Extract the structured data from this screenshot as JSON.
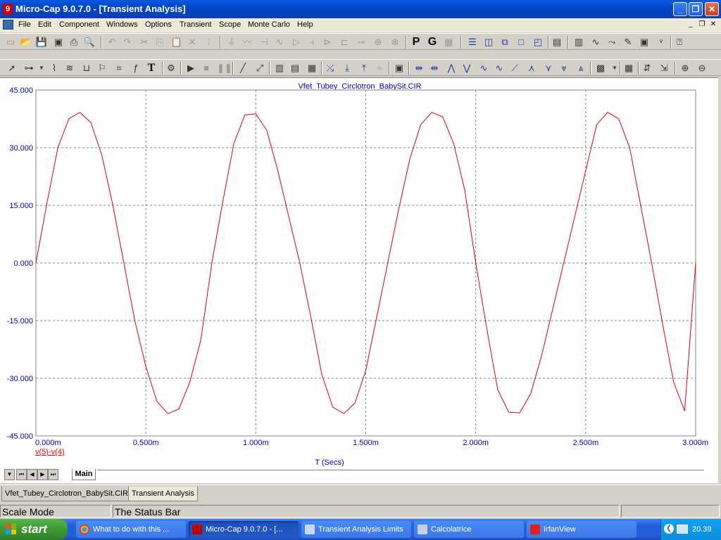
{
  "window": {
    "title": "Micro-Cap 9.0.7.0 - [Transient Analysis]",
    "logo_glyph": "9"
  },
  "menu": [
    "File",
    "Edit",
    "Component",
    "Windows",
    "Options",
    "Transient",
    "Scope",
    "Monte Carlo",
    "Help"
  ],
  "toolbar1": {
    "text_buttons": [
      "P",
      "G"
    ]
  },
  "plot": {
    "colors": {
      "curve": "#e00000",
      "axis_text": "#0000c0",
      "grid": "#808080"
    },
    "tab_label": "Main"
  },
  "chart_data": {
    "type": "line",
    "title": "Vfet_Tubey_Circlotron_BabySit.CIR",
    "xlabel": "T (Secs)",
    "ylabel": "",
    "xlim": [
      0,
      0.003
    ],
    "ylim": [
      -45,
      45
    ],
    "x_tick_labels": [
      "0.000m",
      "0.500m",
      "1.000m",
      "1.500m",
      "2.000m",
      "2.500m",
      "3.000m"
    ],
    "y_tick_labels": [
      "45.000",
      "30.000",
      "15.000",
      "0.000",
      "-15.000",
      "-30.000",
      "-45.000"
    ],
    "grid": true,
    "series": [
      {
        "name": "v(5)-v(4)",
        "color": "#e00000",
        "x": [
          0,
          5e-05,
          0.0001,
          0.00015,
          0.0002,
          0.00025,
          0.0003,
          0.00035,
          0.0004,
          0.00045,
          0.0005,
          0.00055,
          0.0006,
          0.00065,
          0.0007,
          0.00075,
          0.0008,
          0.00085,
          0.0009,
          0.00095,
          0.001,
          0.00105,
          0.0011,
          0.00115,
          0.0012,
          0.00125,
          0.0013,
          0.00135,
          0.0014,
          0.00145,
          0.0015,
          0.00155,
          0.0016,
          0.00165,
          0.0017,
          0.00175,
          0.0018,
          0.00185,
          0.0019,
          0.00195,
          0.002,
          0.00205,
          0.0021,
          0.00215,
          0.0022,
          0.00225,
          0.0023,
          0.00235,
          0.0024,
          0.00245,
          0.0025,
          0.00255,
          0.0026,
          0.00265,
          0.0027,
          0.00275,
          0.0028,
          0.00285,
          0.0029,
          0.00295,
          0.003
        ],
        "y": [
          0,
          15.5,
          30,
          37.5,
          39.2,
          36.5,
          28,
          15,
          0,
          -15,
          -27,
          -36,
          -39.2,
          -38,
          -31,
          -20,
          0,
          16,
          31,
          38.5,
          38.8,
          34.5,
          24,
          12,
          0,
          -14,
          -29,
          -37.5,
          -39.2,
          -36.5,
          -28,
          -14,
          0,
          14,
          27,
          36,
          39.2,
          38,
          31,
          19,
          0,
          -17,
          -33,
          -38.8,
          -39,
          -34,
          -24,
          -12,
          0,
          12,
          24,
          36,
          39.2,
          37.5,
          30,
          15,
          0,
          -16,
          -31,
          -38.5,
          0
        ]
      }
    ]
  },
  "doc_tabs": [
    "Vfet_Tubey_Circlotron_BabySit.CIR",
    "Transient Analysis"
  ],
  "status": {
    "mode": "Scale Mode",
    "message": "The Status Bar"
  },
  "taskbar": {
    "start_label": "start",
    "tasks": [
      {
        "label": "What to do with this ...",
        "icon_color": "#e8b020"
      },
      {
        "label": "Micro-Cap 9.0.7.0 - [...",
        "icon_color": "#c00000"
      },
      {
        "label": "Transient Analysis Limits",
        "icon_color": "#c8d8f0"
      },
      {
        "label": "Calcolatrice",
        "icon_color": "#c8d0e0"
      },
      {
        "label": "IrfanView",
        "icon_color": "#e02020"
      }
    ],
    "clock": "20.39"
  }
}
